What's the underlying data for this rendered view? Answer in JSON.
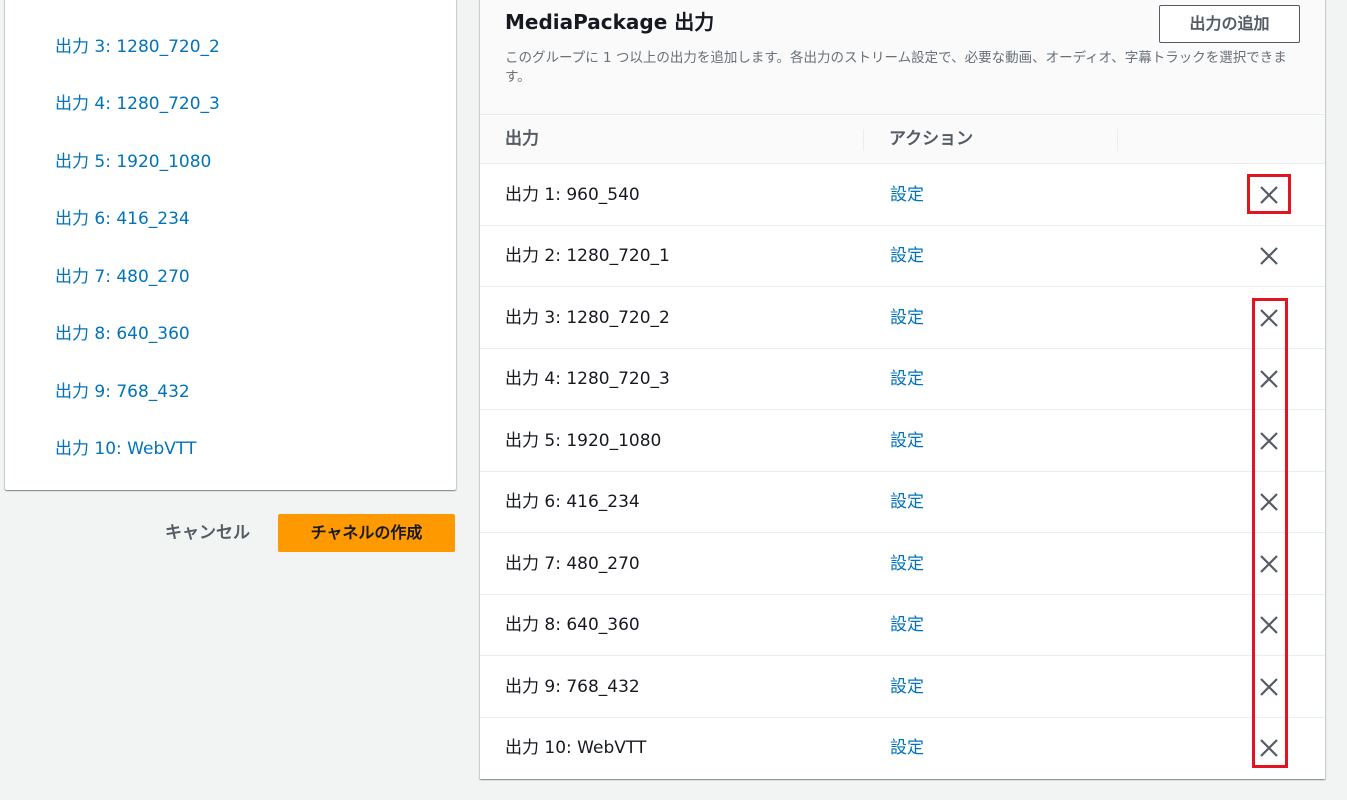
{
  "left_nav": {
    "items": [
      {
        "label": "出力 3: 1280_720_2"
      },
      {
        "label": "出力 4: 1280_720_3"
      },
      {
        "label": "出力 5: 1920_1080"
      },
      {
        "label": "出力 6: 416_234"
      },
      {
        "label": "出力 7: 480_270"
      },
      {
        "label": "出力 8: 640_360"
      },
      {
        "label": "出力 9: 768_432"
      },
      {
        "label": "出力 10: WebVTT"
      }
    ]
  },
  "footer": {
    "cancel_label": "キャンセル",
    "create_label": "チャネルの作成"
  },
  "panel": {
    "title": "MediaPackage 出力",
    "description": "このグループに 1 つ以上の出力を追加します。各出力のストリーム設定で、必要な動画、オーディオ、字幕トラックを選択できます。",
    "add_button_label": "出力の追加",
    "columns": {
      "output": "出力",
      "action": "アクション"
    },
    "rows": [
      {
        "name": "出力 1: 960_540",
        "action": "設定"
      },
      {
        "name": "出力 2: 1280_720_1",
        "action": "設定"
      },
      {
        "name": "出力 3: 1280_720_2",
        "action": "設定"
      },
      {
        "name": "出力 4: 1280_720_3",
        "action": "設定"
      },
      {
        "name": "出力 5: 1920_1080",
        "action": "設定"
      },
      {
        "name": "出力 6: 416_234",
        "action": "設定"
      },
      {
        "name": "出力 7: 480_270",
        "action": "設定"
      },
      {
        "name": "出力 8: 640_360",
        "action": "設定"
      },
      {
        "name": "出力 9: 768_432",
        "action": "設定"
      },
      {
        "name": "出力 10: WebVTT",
        "action": "設定"
      }
    ]
  },
  "icons": {
    "remove": "close-icon"
  },
  "colors": {
    "link": "#0073bb",
    "primary_button": "#ff9900",
    "highlight": "#e1141f"
  }
}
